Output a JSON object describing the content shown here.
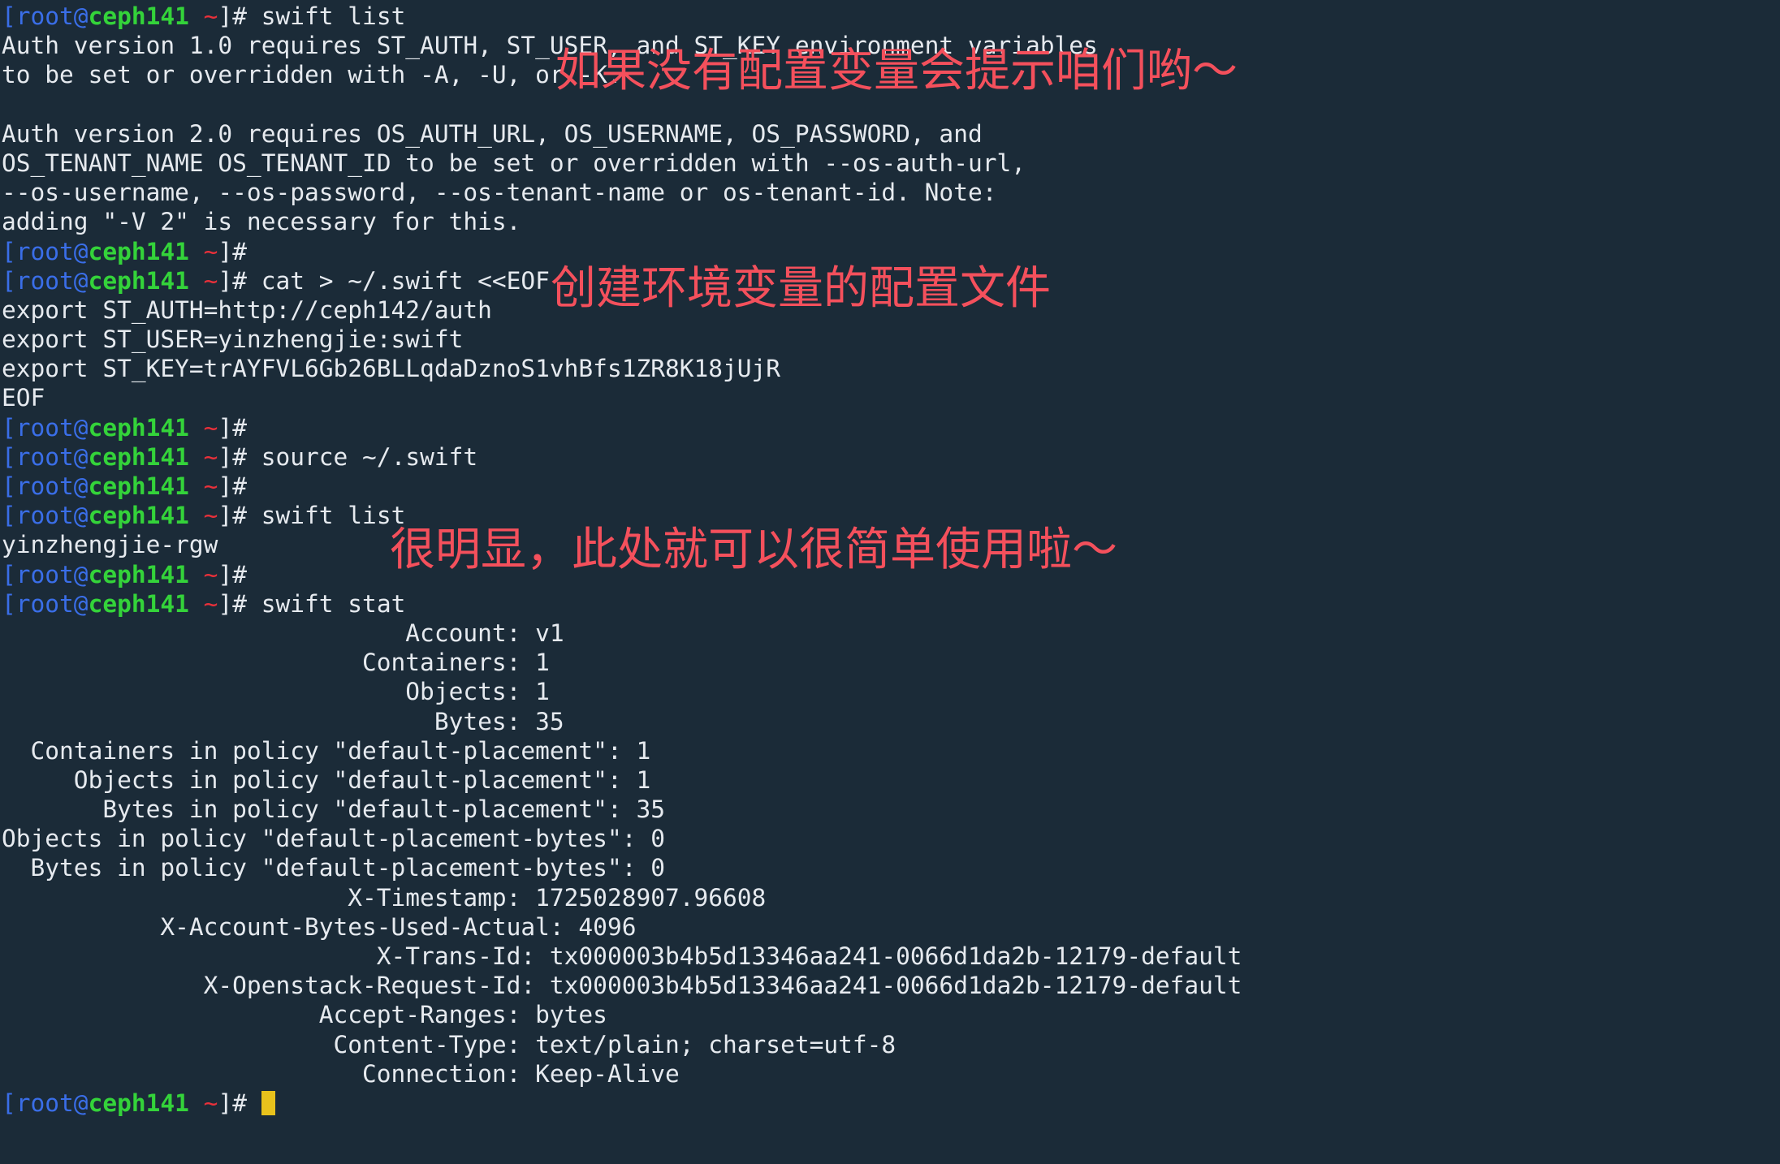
{
  "terminal": {
    "background_color": "#1b2b38",
    "foreground_color": "#e6eaef",
    "prompt": {
      "bracket_open": "[",
      "user": "root@",
      "host": "ceph141",
      "path": " ~",
      "bracket_close": "]# ",
      "colors": {
        "bracket": "#3a6ee8",
        "user": "#3a6ee8",
        "host": "#34d33a",
        "path": "#e8303a",
        "text": "#e6eaef",
        "cursor": "#e8c21c"
      }
    },
    "lines": [
      {
        "type": "prompt",
        "command": "swift list"
      },
      {
        "type": "output",
        "text": "Auth version 1.0 requires ST_AUTH, ST_USER, and ST_KEY environment variables"
      },
      {
        "type": "output",
        "text": "to be set or overridden with -A, -U, or -K."
      },
      {
        "type": "output",
        "text": ""
      },
      {
        "type": "output",
        "text": "Auth version 2.0 requires OS_AUTH_URL, OS_USERNAME, OS_PASSWORD, and"
      },
      {
        "type": "output",
        "text": "OS_TENANT_NAME OS_TENANT_ID to be set or overridden with --os-auth-url,"
      },
      {
        "type": "output",
        "text": "--os-username, --os-password, --os-tenant-name or os-tenant-id. Note:"
      },
      {
        "type": "output",
        "text": "adding \"-V 2\" is necessary for this."
      },
      {
        "type": "prompt",
        "command": ""
      },
      {
        "type": "prompt",
        "command": "cat > ~/.swift <<EOF"
      },
      {
        "type": "output",
        "text": "export ST_AUTH=http://ceph142/auth"
      },
      {
        "type": "output",
        "text": "export ST_USER=yinzhengjie:swift"
      },
      {
        "type": "output",
        "text": "export ST_KEY=trAYFVL6Gb26BLLqdaDznoS1vhBfs1ZR8K18jUjR"
      },
      {
        "type": "output",
        "text": "EOF"
      },
      {
        "type": "prompt",
        "command": ""
      },
      {
        "type": "prompt",
        "command": "source ~/.swift"
      },
      {
        "type": "prompt",
        "command": ""
      },
      {
        "type": "prompt",
        "command": "swift list"
      },
      {
        "type": "output",
        "text": "yinzhengjie-rgw"
      },
      {
        "type": "prompt",
        "command": ""
      },
      {
        "type": "prompt",
        "command": "swift stat"
      },
      {
        "type": "output",
        "text": "                            Account: v1"
      },
      {
        "type": "output",
        "text": "                         Containers: 1"
      },
      {
        "type": "output",
        "text": "                            Objects: 1"
      },
      {
        "type": "output",
        "text": "                              Bytes: 35"
      },
      {
        "type": "output",
        "text": "  Containers in policy \"default-placement\": 1"
      },
      {
        "type": "output",
        "text": "     Objects in policy \"default-placement\": 1"
      },
      {
        "type": "output",
        "text": "       Bytes in policy \"default-placement\": 35"
      },
      {
        "type": "output",
        "text": "Objects in policy \"default-placement-bytes\": 0"
      },
      {
        "type": "output",
        "text": "  Bytes in policy \"default-placement-bytes\": 0"
      },
      {
        "type": "output",
        "text": "                        X-Timestamp: 1725028907.96608"
      },
      {
        "type": "output",
        "text": "           X-Account-Bytes-Used-Actual: 4096"
      },
      {
        "type": "output",
        "text": "                          X-Trans-Id: tx000003b4b5d13346aa241-0066d1da2b-12179-default"
      },
      {
        "type": "output",
        "text": "              X-Openstack-Request-Id: tx000003b4b5d13346aa241-0066d1da2b-12179-default"
      },
      {
        "type": "output",
        "text": "                      Accept-Ranges: bytes"
      },
      {
        "type": "output",
        "text": "                       Content-Type: text/plain; charset=utf-8"
      },
      {
        "type": "output",
        "text": "                         Connection: Keep-Alive"
      },
      {
        "type": "prompt_cursor",
        "command": ""
      }
    ]
  },
  "annotations": [
    {
      "text": "如果没有配置变量会提示咱们哟～",
      "color": "#f4505c"
    },
    {
      "text": "创建环境变量的配置文件",
      "color": "#f4505c"
    },
    {
      "text": "很明显，此处就可以很简单使用啦～",
      "color": "#f4505c"
    }
  ]
}
